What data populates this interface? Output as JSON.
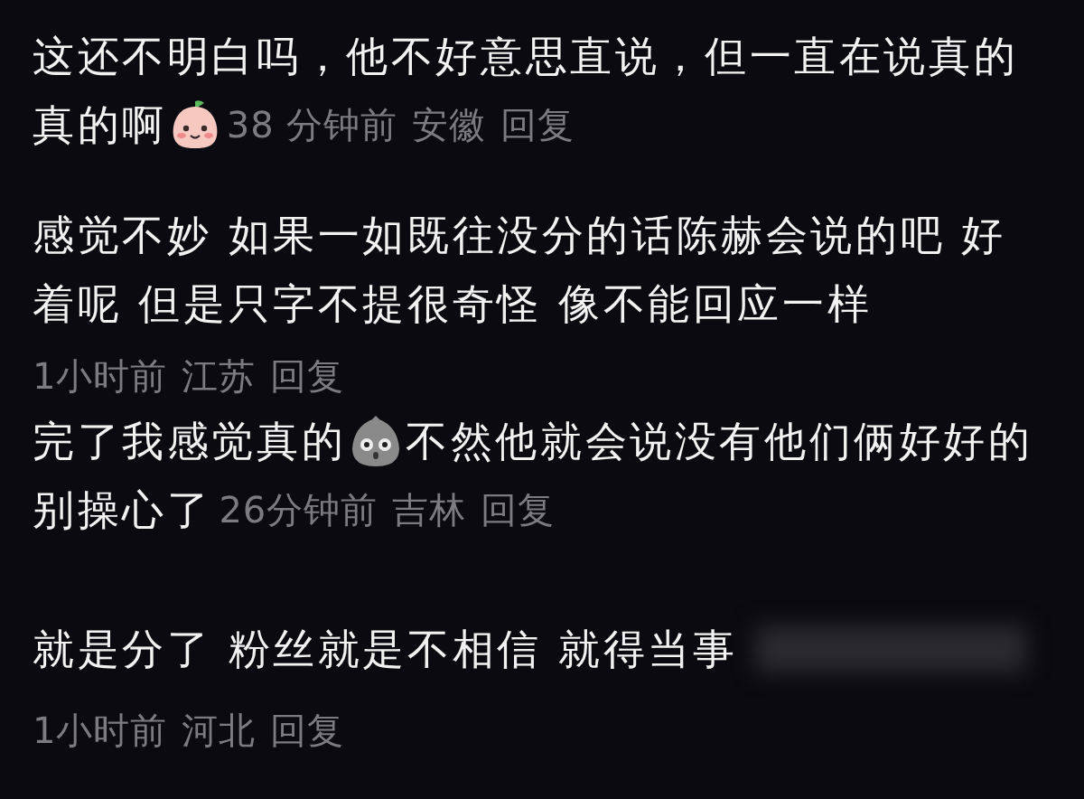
{
  "comments": [
    {
      "lines": [
        [
          {
            "kind": "text",
            "text": "这还不明白吗，他不好意思直说，但一直在说真的"
          }
        ],
        [
          {
            "kind": "text",
            "text": "真的啊"
          },
          {
            "kind": "peach_emoji"
          },
          {
            "kind": "time",
            "text": "38 分钟前"
          },
          {
            "kind": "location",
            "text": "安徽"
          },
          {
            "kind": "reply",
            "text": "回复"
          }
        ]
      ]
    },
    {
      "lines": [
        [
          {
            "kind": "text",
            "text": "感觉不妙 如果一如既往没分的话陈赫会说的吧 好"
          }
        ],
        [
          {
            "kind": "text",
            "text": "着呢 但是只字不提很奇怪 像不能回应一样"
          }
        ],
        [
          {
            "kind": "time",
            "text": "1小时前"
          },
          {
            "kind": "location",
            "text": "江苏"
          },
          {
            "kind": "reply",
            "text": "回复"
          }
        ]
      ]
    },
    {
      "lines": [
        [
          {
            "kind": "text",
            "text": "完了我感觉真的"
          },
          {
            "kind": "shock_emoji"
          },
          {
            "kind": "text",
            "text": "不然他就会说没有他们俩好好的"
          }
        ],
        [
          {
            "kind": "text",
            "text": "别操心了"
          },
          {
            "kind": "time",
            "text": "26分钟前"
          },
          {
            "kind": "location",
            "text": "吉林"
          },
          {
            "kind": "reply",
            "text": "回复"
          }
        ]
      ]
    },
    {
      "lines": [
        [
          {
            "kind": "text",
            "text": "就是分了 粉丝就是不相信 就得当事"
          },
          {
            "kind": "blurred"
          }
        ],
        [
          {
            "kind": "time",
            "text": "1小时前"
          },
          {
            "kind": "location",
            "text": "河北"
          },
          {
            "kind": "reply",
            "text": "回复"
          }
        ]
      ]
    }
  ]
}
